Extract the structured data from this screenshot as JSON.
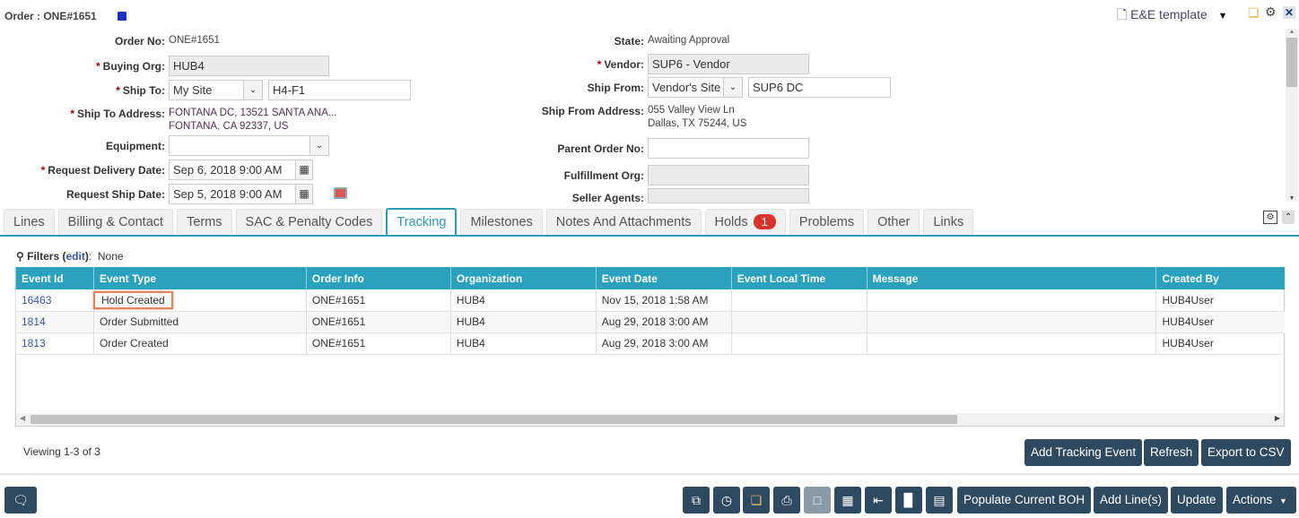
{
  "header": {
    "title": "Order : ONE#1651",
    "template": "E&E template"
  },
  "left_form": {
    "order_no": {
      "label": "Order No:",
      "value": "ONE#1651"
    },
    "buying_org": {
      "label": "Buying Org:",
      "value": "HUB4"
    },
    "ship_to": {
      "label": "Ship To:",
      "select": "My Site",
      "value": "H4-F1"
    },
    "ship_to_address": {
      "label": "Ship To Address:",
      "line1": "FONTANA DC, 13521 SANTA ANA...",
      "line2": "FONTANA, CA 92337, US"
    },
    "equipment": {
      "label": "Equipment:",
      "value": ""
    },
    "request_delivery_date": {
      "label": "Request Delivery Date:",
      "value": "Sep 6, 2018 9:00 AM"
    },
    "request_ship_date": {
      "label": "Request Ship Date:",
      "value": "Sep 5, 2018 9:00 AM"
    }
  },
  "right_form": {
    "state": {
      "label": "State:",
      "value": "Awaiting Approval"
    },
    "vendor": {
      "label": "Vendor:",
      "value": "SUP6 - Vendor"
    },
    "ship_from": {
      "label": "Ship From:",
      "select": "Vendor's Site",
      "value": "SUP6 DC"
    },
    "ship_from_address": {
      "label": "Ship From Address:",
      "line1": "055 Valley View Ln",
      "line2": "Dallas, TX 75244, US"
    },
    "parent_order_no": {
      "label": "Parent Order No:",
      "value": ""
    },
    "fulfillment_org": {
      "label": "Fulfillment Org:",
      "value": ""
    },
    "seller_agents": {
      "label": "Seller Agents:",
      "value": ""
    }
  },
  "tabs": [
    {
      "label": "Lines"
    },
    {
      "label": "Billing & Contact"
    },
    {
      "label": "Terms"
    },
    {
      "label": "SAC & Penalty Codes"
    },
    {
      "label": "Tracking",
      "active": true
    },
    {
      "label": "Milestones"
    },
    {
      "label": "Notes And Attachments"
    },
    {
      "label": "Holds",
      "badge": "1"
    },
    {
      "label": "Problems"
    },
    {
      "label": "Other"
    },
    {
      "label": "Links"
    }
  ],
  "filters": {
    "label": "Filters",
    "edit": "edit",
    "value": "None"
  },
  "table": {
    "columns": [
      "Event Id",
      "Event Type",
      "Order Info",
      "Organization",
      "Event Date",
      "Event Local Time",
      "Message",
      "Created By"
    ],
    "rows": [
      [
        "16463",
        "Hold Created",
        "ONE#1651",
        "HUB4",
        "Nov 15, 2018 1:58 AM",
        "",
        "",
        "HUB4User"
      ],
      [
        "1814",
        "Order Submitted",
        "ONE#1651",
        "HUB4",
        "Aug 29, 2018 3:00 AM",
        "",
        "",
        "HUB4User"
      ],
      [
        "1813",
        "Order Created",
        "ONE#1651",
        "HUB4",
        "Aug 29, 2018 3:00 AM",
        "",
        "",
        "HUB4User"
      ]
    ]
  },
  "viewing": "Viewing 1-3 of 3",
  "actions": {
    "add_tracking": "Add Tracking Event",
    "refresh": "Refresh",
    "export": "Export to CSV"
  },
  "footer": {
    "populate": "Populate Current BOH",
    "add_lines": "Add Line(s)",
    "update": "Update",
    "actions": "Actions"
  },
  "colors": {
    "accent": "#2aa1bd",
    "button": "#2e4a60",
    "badge": "#d9342b",
    "highlight": "#e8805a"
  }
}
